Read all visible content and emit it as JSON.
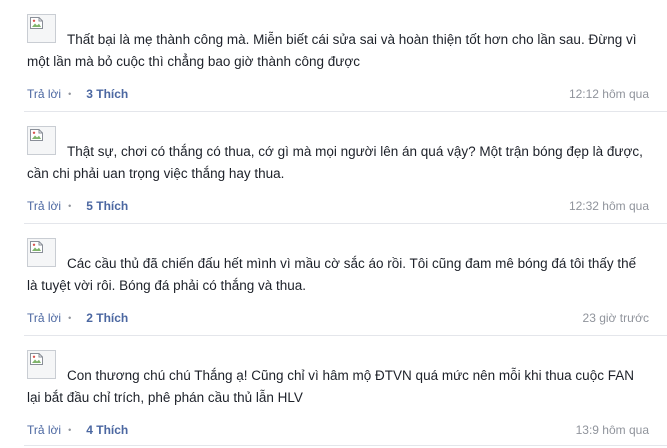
{
  "comments": [
    {
      "text": "Thất bại là mẹ thành công mà. Miễn biết cái sửa sai và hoàn thiện tốt hơn cho lần sau. Đừng vì một lần mà bỏ cuộc thì chẳng bao giờ thành công được",
      "reply_label": "Trả lời",
      "separator": "•",
      "likes_label": "3 Thích",
      "time": "12:12 hôm qua"
    },
    {
      "text": "Thật sự, chơi có thắng có thua, cớ gì mà mọi người lên án quá vậy? Một trận bóng đẹp là được, cần chi phải uan trọng việc thắng hay thua.",
      "reply_label": "Trả lời",
      "separator": "•",
      "likes_label": "5 Thích",
      "time": "12:32 hôm qua"
    },
    {
      "text": "Các cầu thủ đã chiến đấu hết mình vì mầu cờ sắc áo rồi. Tôi cũng đam mê bóng đá tôi thấy thế là tuyệt vời rôi. Bóng đá phải có thắng và thua.",
      "reply_label": "Trả lời",
      "separator": "•",
      "likes_label": "2 Thích",
      "time": "23 giờ trước"
    },
    {
      "text": "Con thương chú chú Thắng ạ! Cũng chỉ vì hâm mộ ĐTVN quá mức nên mỗi khi thua cuộc FAN lại bắt đầu chỉ trích, phê phán cầu thủ lẫn HLV",
      "reply_label": "Trả lời",
      "separator": "•",
      "likes_label": "4 Thích",
      "time": "13:9 hôm qua"
    }
  ]
}
